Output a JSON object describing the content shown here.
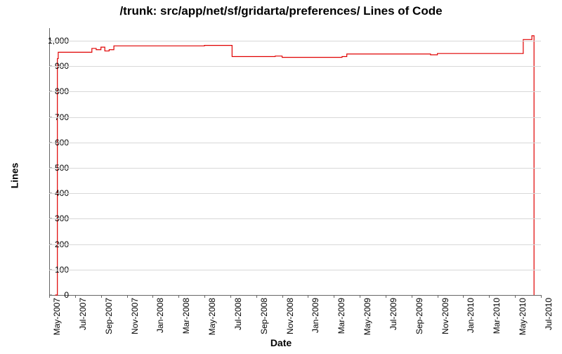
{
  "chart_data": {
    "type": "line",
    "title": "/trunk: src/app/net/sf/gridarta/preferences/ Lines of Code",
    "xlabel": "Date",
    "ylabel": "Lines",
    "ylim": [
      0,
      1050
    ],
    "xlim": [
      "2007-05",
      "2010-07"
    ],
    "xticks": [
      "May-2007",
      "Jul-2007",
      "Sep-2007",
      "Nov-2007",
      "Jan-2008",
      "Mar-2008",
      "May-2008",
      "Jul-2008",
      "Sep-2008",
      "Nov-2008",
      "Jan-2009",
      "Mar-2009",
      "May-2009",
      "Jul-2009",
      "Sep-2009",
      "Nov-2009",
      "Jan-2010",
      "Mar-2010",
      "May-2010",
      "Jul-2010"
    ],
    "yticks": [
      0,
      100,
      200,
      300,
      400,
      500,
      600,
      700,
      800,
      900,
      1000
    ],
    "x": [
      "2007-05-15",
      "2007-05-20",
      "2007-05-22",
      "2007-07-15",
      "2007-08-10",
      "2007-08-20",
      "2007-09-01",
      "2007-09-10",
      "2007-09-20",
      "2007-10-01",
      "2007-11-01",
      "2008-01-01",
      "2008-03-01",
      "2008-05-01",
      "2008-07-01",
      "2008-07-05",
      "2008-09-01",
      "2008-10-15",
      "2008-11-01",
      "2009-01-01",
      "2009-03-01",
      "2009-03-20",
      "2009-04-01",
      "2009-05-01",
      "2009-07-01",
      "2009-09-01",
      "2009-10-01",
      "2009-10-15",
      "2009-11-01",
      "2010-01-01",
      "2010-03-01",
      "2010-05-01",
      "2010-05-20",
      "2010-05-25",
      "2010-06-10",
      "2010-06-15"
    ],
    "values": [
      0,
      930,
      955,
      955,
      970,
      965,
      975,
      960,
      965,
      980,
      980,
      980,
      980,
      982,
      982,
      938,
      938,
      940,
      935,
      935,
      935,
      938,
      948,
      948,
      948,
      948,
      948,
      945,
      950,
      950,
      950,
      950,
      1005,
      1005,
      1020,
      0
    ]
  }
}
